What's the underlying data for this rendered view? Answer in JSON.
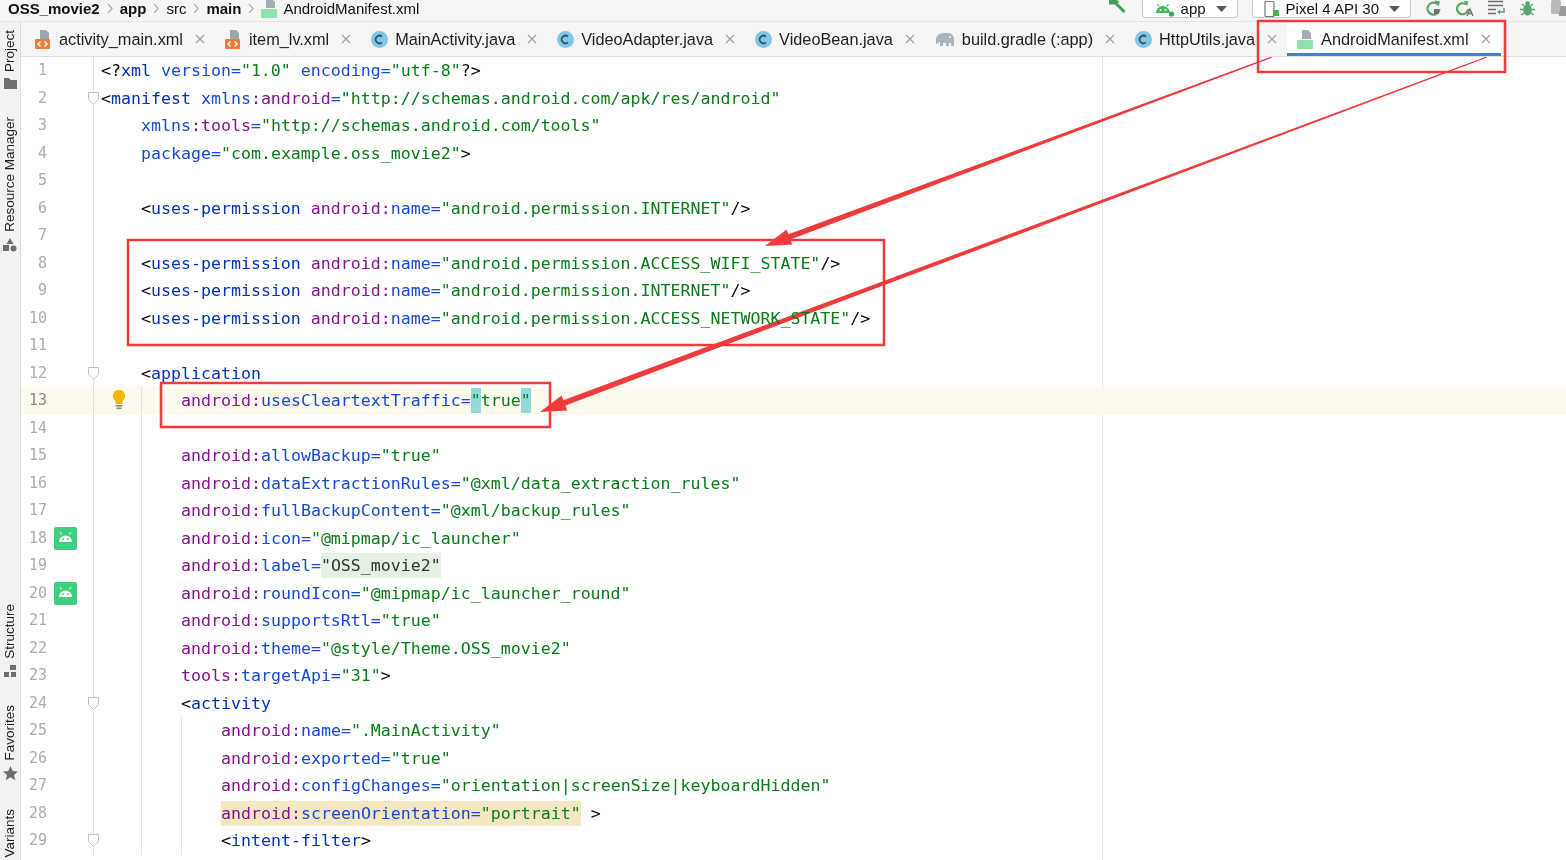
{
  "breadcrumb": [
    {
      "label": "OSS_movie2",
      "bold": true,
      "kind": "directory"
    },
    {
      "label": "app",
      "bold": true,
      "kind": "directory"
    },
    {
      "label": "src",
      "bold": false,
      "kind": "directory"
    },
    {
      "label": "main",
      "bold": true,
      "kind": "directory"
    },
    {
      "label": "AndroidManifest.xml",
      "bold": false,
      "kind": "file"
    }
  ],
  "run_toolbar": {
    "configuration": "app",
    "device": "Pixel 4 API 30"
  },
  "tool_strip": {
    "top": [
      {
        "label": "Project",
        "kind": "project"
      },
      {
        "label": "Resource Manager",
        "kind": "resources"
      }
    ],
    "bottom": [
      {
        "label": "Structure",
        "kind": "structure"
      },
      {
        "label": "Favorites",
        "kind": "favorites"
      },
      {
        "label": "Variants",
        "kind": "variants"
      }
    ]
  },
  "tabs": [
    {
      "label": "activity_main.xml",
      "kind": "xml",
      "selected": false
    },
    {
      "label": "item_lv.xml",
      "kind": "xml",
      "selected": false
    },
    {
      "label": "MainActivity.java",
      "kind": "class",
      "selected": false
    },
    {
      "label": "VideoAdapter.java",
      "kind": "class",
      "selected": false
    },
    {
      "label": "VideoBean.java",
      "kind": "class",
      "selected": false
    },
    {
      "label": "build.gradle (:app)",
      "kind": "gradle",
      "selected": false
    },
    {
      "label": "HttpUtils.java",
      "kind": "class",
      "selected": false
    },
    {
      "label": "AndroidManifest.xml",
      "kind": "manifest",
      "selected": true
    }
  ],
  "editor": {
    "lines": [
      {
        "number": "1",
        "current": false,
        "foldable": false,
        "tokens": [
          {
            "kind": "punct",
            "text": "<?"
          },
          {
            "kind": "tag",
            "text": "xml"
          },
          {
            "kind": "attr",
            "text": " version="
          },
          {
            "kind": "value",
            "text": "\"1.0\""
          },
          {
            "kind": "attr",
            "text": " encoding="
          },
          {
            "kind": "value",
            "text": "\"utf-8\""
          },
          {
            "kind": "punct",
            "text": "?>"
          }
        ]
      },
      {
        "number": "2",
        "current": false,
        "foldable": true,
        "tokens": [
          {
            "kind": "punct",
            "text": "<"
          },
          {
            "kind": "tag",
            "text": "manifest"
          },
          {
            "kind": "attr",
            "text": " xmlns"
          },
          {
            "kind": "ns",
            "text": ":android"
          },
          {
            "kind": "attr",
            "text": "="
          },
          {
            "kind": "value",
            "text": "\"http://schemas.android.com/apk/res/android\""
          }
        ],
        "children": [
          {
            "number": "3",
            "current": false,
            "foldable": false,
            "tokens": [
              {
                "kind": "attr",
                "text": "xmlns"
              },
              {
                "kind": "ns",
                "text": ":tools"
              },
              {
                "kind": "attr",
                "text": "="
              },
              {
                "kind": "value",
                "text": "\"http://schemas.android.com/tools\""
              }
            ]
          },
          {
            "number": "4",
            "current": false,
            "foldable": false,
            "tokens": [
              {
                "kind": "attr",
                "text": "package="
              },
              {
                "kind": "value",
                "text": "\"com.example.oss_movie2\""
              },
              {
                "kind": "punct",
                "text": ">"
              }
            ]
          },
          {
            "number": "5",
            "current": false,
            "foldable": false
          },
          {
            "number": "6",
            "current": false,
            "foldable": false,
            "tokens": [
              {
                "kind": "punct",
                "text": "<"
              },
              {
                "kind": "tag",
                "text": "uses-permission"
              },
              {
                "kind": "ns",
                "text": " android:"
              },
              {
                "kind": "attr",
                "text": "name="
              },
              {
                "kind": "value",
                "text": "\"android.permission.INTERNET\""
              },
              {
                "kind": "punct",
                "text": "/>"
              }
            ]
          },
          {
            "number": "7",
            "current": false,
            "foldable": false
          },
          {
            "number": "8",
            "current": false,
            "foldable": false,
            "tokens": [
              {
                "kind": "punct",
                "text": "<"
              },
              {
                "kind": "tag",
                "text": "uses-permission"
              },
              {
                "kind": "ns",
                "text": " android:"
              },
              {
                "kind": "attr",
                "text": "name="
              },
              {
                "kind": "value",
                "text": "\"android.permission.ACCESS_WIFI_STATE\""
              },
              {
                "kind": "punct",
                "text": "/>"
              }
            ]
          },
          {
            "number": "9",
            "current": false,
            "foldable": false,
            "tokens": [
              {
                "kind": "punct",
                "text": "<"
              },
              {
                "kind": "tag",
                "text": "uses-permission"
              },
              {
                "kind": "ns",
                "text": " android:"
              },
              {
                "kind": "attr",
                "text": "name="
              },
              {
                "kind": "value",
                "text": "\"android.permission.INTERNET\""
              },
              {
                "kind": "punct",
                "text": "/>"
              }
            ]
          },
          {
            "number": "10",
            "current": false,
            "foldable": false,
            "tokens": [
              {
                "kind": "punct",
                "text": "<"
              },
              {
                "kind": "tag",
                "text": "uses-permission"
              },
              {
                "kind": "ns",
                "text": " android:"
              },
              {
                "kind": "attr",
                "text": "name="
              },
              {
                "kind": "value",
                "text": "\"android.permission.ACCESS_NETWORK_STATE\""
              },
              {
                "kind": "punct",
                "text": "/>"
              }
            ]
          },
          {
            "number": "11",
            "current": false,
            "foldable": false
          },
          {
            "number": "12",
            "current": false,
            "foldable": true,
            "tokens": [
              {
                "kind": "punct",
                "text": "<"
              },
              {
                "kind": "tag",
                "text": "application"
              }
            ],
            "children": [
              {
                "number": "13",
                "kind": "intention",
                "current": true,
                "foldable": false,
                "tokens": [
                  {
                    "kind": "ns",
                    "text": "android:"
                  },
                  {
                    "kind": "attr",
                    "text": "usesCleartextTraffic="
                  },
                  {
                    "kind": "match",
                    "text": "\""
                  },
                  {
                    "kind": "value",
                    "text": "true"
                  },
                  {
                    "kind": "match",
                    "text": "\""
                  }
                ]
              },
              {
                "number": "14",
                "current": false,
                "foldable": false
              },
              {
                "number": "15",
                "current": false,
                "foldable": false,
                "tokens": [
                  {
                    "kind": "ns",
                    "text": "android:"
                  },
                  {
                    "kind": "attr",
                    "text": "allowBackup="
                  },
                  {
                    "kind": "value",
                    "text": "\"true\""
                  }
                ]
              },
              {
                "number": "16",
                "current": false,
                "foldable": false,
                "tokens": [
                  {
                    "kind": "ns",
                    "text": "android:"
                  },
                  {
                    "kind": "attr",
                    "text": "dataExtractionRules="
                  },
                  {
                    "kind": "value",
                    "text": "\"@xml/data_extraction_rules\""
                  }
                ]
              },
              {
                "number": "17",
                "current": false,
                "foldable": false,
                "tokens": [
                  {
                    "kind": "ns",
                    "text": "android:"
                  },
                  {
                    "kind": "attr",
                    "text": "fullBackupContent="
                  },
                  {
                    "kind": "value",
                    "text": "\"@xml/backup_rules\""
                  }
                ]
              },
              {
                "number": "18",
                "kind": "resource",
                "current": false,
                "foldable": false,
                "tokens": [
                  {
                    "kind": "ns",
                    "text": "android:"
                  },
                  {
                    "kind": "attr",
                    "text": "icon="
                  },
                  {
                    "kind": "value",
                    "text": "\"@mipmap/ic_launcher\""
                  }
                ]
              },
              {
                "number": "19",
                "current": false,
                "foldable": false,
                "tokens": [
                  {
                    "kind": "ns",
                    "text": "android:"
                  },
                  {
                    "kind": "attr",
                    "text": "label="
                  },
                  {
                    "kind": "folded",
                    "text": "\"OSS_movie2\""
                  }
                ]
              },
              {
                "number": "20",
                "kind": "resource",
                "current": false,
                "foldable": false,
                "tokens": [
                  {
                    "kind": "ns",
                    "text": "android:"
                  },
                  {
                    "kind": "attr",
                    "text": "roundIcon="
                  },
                  {
                    "kind": "value",
                    "text": "\"@mipmap/ic_launcher_round\""
                  }
                ]
              },
              {
                "number": "21",
                "current": false,
                "foldable": false,
                "tokens": [
                  {
                    "kind": "ns",
                    "text": "android:"
                  },
                  {
                    "kind": "attr",
                    "text": "supportsRtl="
                  },
                  {
                    "kind": "value",
                    "text": "\"true\""
                  }
                ]
              },
              {
                "number": "22",
                "current": false,
                "foldable": false,
                "tokens": [
                  {
                    "kind": "ns",
                    "text": "android:"
                  },
                  {
                    "kind": "attr",
                    "text": "theme="
                  },
                  {
                    "kind": "value",
                    "text": "\"@style/Theme.OSS_movie2\""
                  }
                ]
              },
              {
                "number": "23",
                "current": false,
                "foldable": false,
                "tokens": [
                  {
                    "kind": "ns",
                    "text": "tools:"
                  },
                  {
                    "kind": "attr",
                    "text": "targetApi="
                  },
                  {
                    "kind": "value",
                    "text": "\"31\""
                  },
                  {
                    "kind": "punct",
                    "text": ">"
                  }
                ]
              },
              {
                "number": "24",
                "current": false,
                "foldable": true,
                "tokens": [
                  {
                    "kind": "punct",
                    "text": "<"
                  },
                  {
                    "kind": "tag",
                    "text": "activity"
                  }
                ],
                "children": [
                  {
                    "number": "25",
                    "current": false,
                    "foldable": false,
                    "tokens": [
                      {
                        "kind": "ns",
                        "text": "android:"
                      },
                      {
                        "kind": "attr",
                        "text": "name="
                      },
                      {
                        "kind": "value",
                        "text": "\".MainActivity\""
                      }
                    ]
                  },
                  {
                    "number": "26",
                    "current": false,
                    "foldable": false,
                    "tokens": [
                      {
                        "kind": "ns",
                        "text": "android:"
                      },
                      {
                        "kind": "attr",
                        "text": "exported="
                      },
                      {
                        "kind": "value",
                        "text": "\"true\""
                      }
                    ]
                  },
                  {
                    "number": "27",
                    "current": false,
                    "foldable": false,
                    "tokens": [
                      {
                        "kind": "ns",
                        "text": "android:"
                      },
                      {
                        "kind": "attr",
                        "text": "configChanges="
                      },
                      {
                        "kind": "value",
                        "text": "\"orientation|screenSize|keyboardHidden\""
                      }
                    ]
                  },
                  {
                    "number": "28",
                    "current": false,
                    "foldable": false,
                    "tokens": [
                      {
                        "kind": "ns",
                        "text": "android:",
                        "warning": true
                      },
                      {
                        "kind": "attr",
                        "text": "screenOrientation=",
                        "warning": true
                      },
                      {
                        "kind": "value",
                        "text": "\"portrait\"",
                        "warning": true
                      },
                      {
                        "kind": "punct",
                        "text": " >",
                        "warning": false
                      }
                    ]
                  },
                  {
                    "number": "29",
                    "current": false,
                    "foldable": true,
                    "tokens": [
                      {
                        "kind": "punct",
                        "text": "<"
                      },
                      {
                        "kind": "tag",
                        "text": "intent-filter"
                      },
                      {
                        "kind": "punct",
                        "text": ">"
                      }
                    ]
                  }
                ]
              }
            ]
          }
        ]
      }
    ]
  }
}
